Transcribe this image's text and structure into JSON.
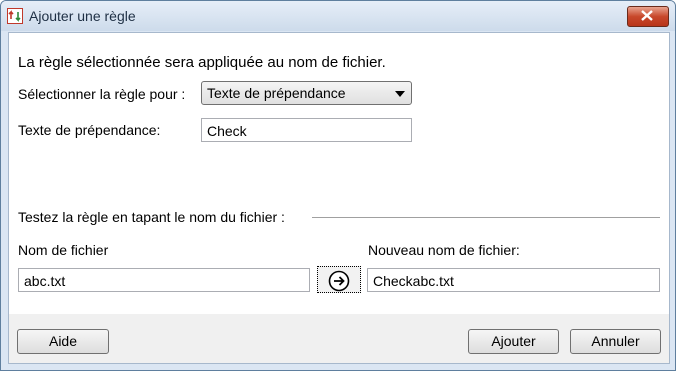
{
  "window": {
    "title": "Ajouter une règle"
  },
  "description": "La règle sélectionnée sera appliquée au nom de fichier.",
  "rule_select": {
    "label": "Sélectionner la règle pour :",
    "value": "Texte de prépendance"
  },
  "prepend": {
    "label": "Texte de prépendance:",
    "value": "Check"
  },
  "test": {
    "heading": "Testez la règle en tapant le nom du fichier :",
    "filename_label": "Nom de fichier",
    "filename_value": "abc.txt",
    "new_label": "Nouveau nom de fichier:",
    "new_value": "Checkabc.txt"
  },
  "buttons": {
    "help": "Aide",
    "add": "Ajouter",
    "cancel": "Annuler"
  },
  "icons": {
    "app": "rename-app-icon",
    "close": "close-icon",
    "apply": "arrow-right-circle-icon"
  }
}
